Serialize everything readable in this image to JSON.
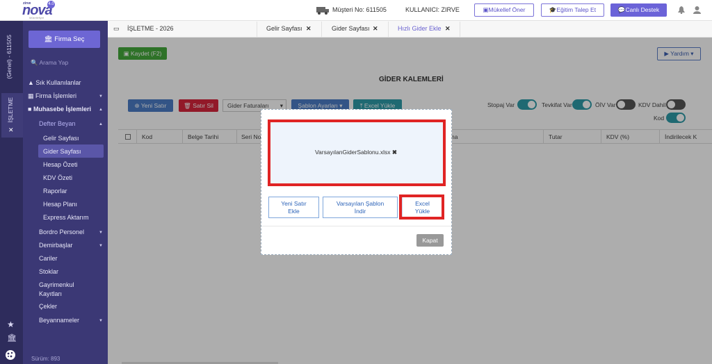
{
  "app": {
    "logo_small": "zirve",
    "logo": "nova",
    "logo_sub": "Mükellefiyet",
    "logo_badge": "4.0"
  },
  "topbar": {
    "customer_no": "Müşteri No: 611505",
    "user": "KULLANICI: ZIRVE",
    "btn_taxpayer": "Mükellef Öner",
    "btn_training": "Eğitim Talep Et",
    "btn_support": "Canlı Destek"
  },
  "strip": {
    "company_label": "(Genel) - 611505",
    "tab_label": "İŞLETME"
  },
  "sidebar": {
    "firma_btn": "Firma Seç",
    "search_placeholder": "Arama Yap",
    "items": [
      "Sık Kullanılanlar",
      "Firma İşlemleri",
      "Muhasebe İşlemleri",
      "Defter Beyan"
    ],
    "sub_items": [
      "Gelir Sayfası",
      "Gider Sayfası",
      "Hesap Özeti",
      "KDV Özeti",
      "Raporlar",
      "Hesap Planı",
      "Express Aktarım"
    ],
    "lower_items": [
      "Bordro Personel",
      "Demirbaşlar",
      "Cariler",
      "Stoklar",
      "Gayrimenkul",
      "Kayıtları",
      "Çekler",
      "Beyannameler"
    ],
    "version": "Sürüm: 893"
  },
  "tabs": {
    "title": "İŞLETME - 2026",
    "t1": "Gelir Sayfası",
    "t2": "Gider Sayfası",
    "t3": "Hızlı Gider Ekle"
  },
  "main": {
    "save": "Kaydet (F2)",
    "help": "Yardım",
    "title": "GİDER KALEMLERİ",
    "new_row": "Yeni Satır",
    "delete_row": "Satır Sil",
    "invoice_select": "Gider Faturaları",
    "template_settings": "Şablon Ayarları",
    "excel_upload": "Excel Yükle",
    "toggles": [
      "Stopaj Var",
      "Tevkifat Var",
      "ÖİV Var",
      "KDV Dahil",
      "Kod"
    ],
    "columns": [
      "Kod",
      "Belge Tarihi",
      "Seri No",
      "na",
      "Tutar",
      "KDV (%)",
      "İndirilecek K"
    ]
  },
  "modal": {
    "filename": "VarsayılanGiderSablonu.xlsx",
    "btn_new_row": [
      "Yeni Satır",
      "Ekle"
    ],
    "btn_download": [
      "Varsayılan Şablon",
      "İndir"
    ],
    "btn_excel": [
      "Excel",
      "Yükle"
    ],
    "close": "Kapat"
  }
}
